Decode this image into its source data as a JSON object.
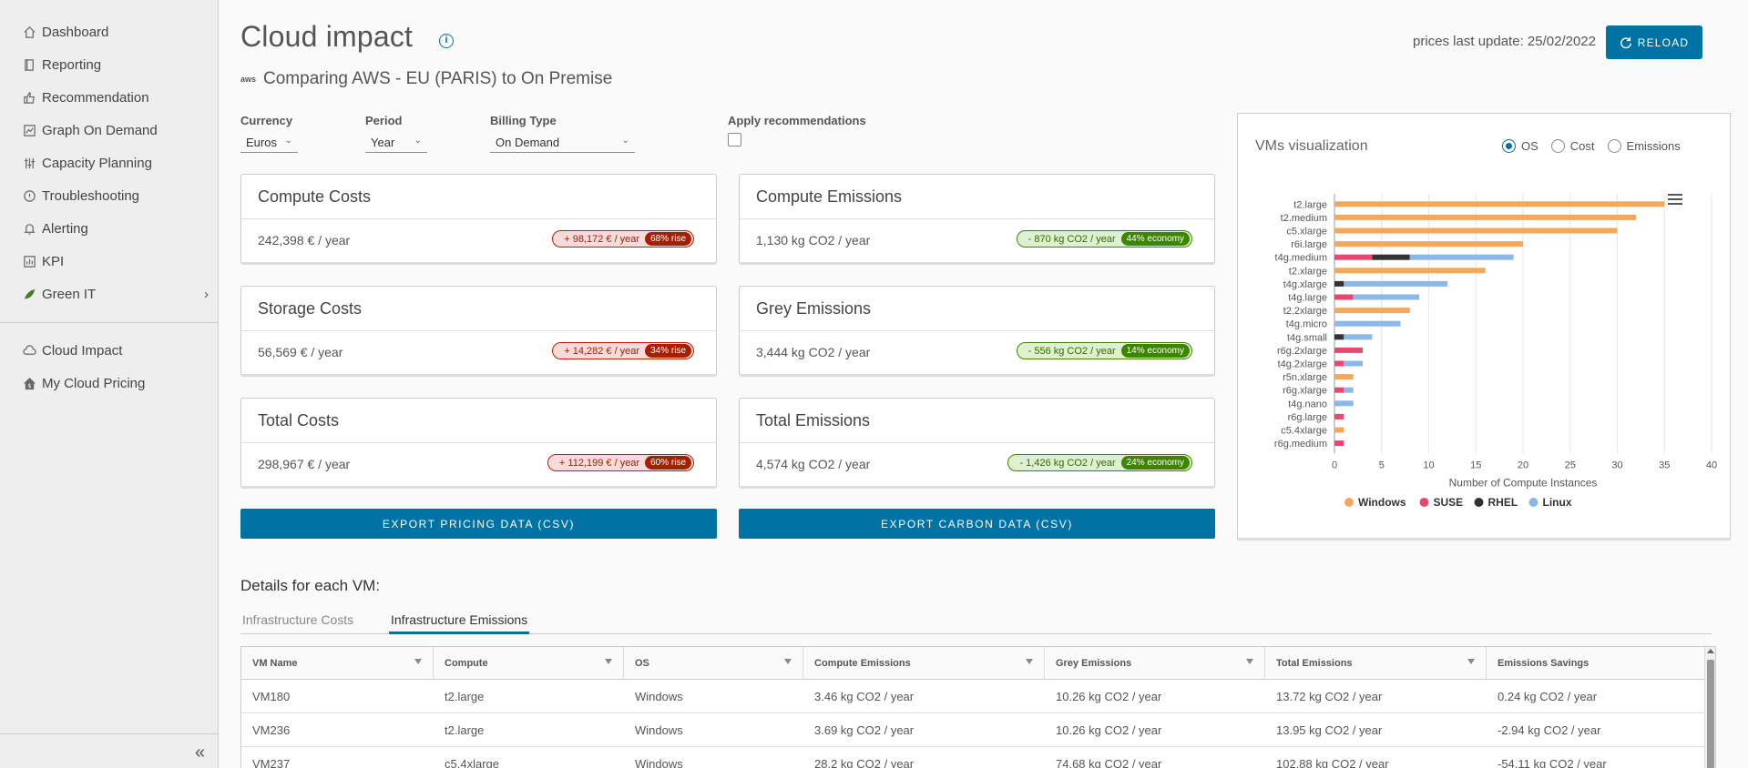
{
  "sidebar": {
    "items": [
      {
        "label": "Dashboard",
        "icon": "home-icon"
      },
      {
        "label": "Reporting",
        "icon": "book-icon"
      },
      {
        "label": "Recommendation",
        "icon": "thumbs-up-icon"
      },
      {
        "label": "Graph On Demand",
        "icon": "chart-icon"
      },
      {
        "label": "Capacity Planning",
        "icon": "sliders-icon"
      },
      {
        "label": "Troubleshooting",
        "icon": "warning-circle-icon"
      },
      {
        "label": "Alerting",
        "icon": "bell-icon"
      },
      {
        "label": "KPI",
        "icon": "kpi-icon"
      },
      {
        "label": "Green IT",
        "icon": "leaf-icon"
      },
      {
        "label": "Cloud Impact",
        "icon": "cloud-icon"
      },
      {
        "label": "My Cloud Pricing",
        "icon": "home-dollar-icon"
      }
    ]
  },
  "header": {
    "title": "Cloud impact",
    "subtitle": "Comparing AWS - EU (PARIS) to On Premise",
    "aws_logo": "aws",
    "prices_update": "prices last update: 25/02/2022",
    "reload_label": "RELOAD"
  },
  "filters": {
    "currency": {
      "label": "Currency",
      "value": "Euros"
    },
    "period": {
      "label": "Period",
      "value": "Year"
    },
    "billing": {
      "label": "Billing Type",
      "value": "On Demand"
    },
    "recommendations": {
      "label": "Apply recommendations",
      "checked": false
    }
  },
  "cards": {
    "compute_costs": {
      "title": "Compute Costs",
      "value": "242,398 € / year",
      "delta": "+ 98,172 € / year",
      "tag": "68% rise"
    },
    "compute_emissions": {
      "title": "Compute Emissions",
      "value": "1,130 kg CO2 / year",
      "delta": "- 870 kg CO2 / year",
      "tag": "44% economy"
    },
    "storage_costs": {
      "title": "Storage Costs",
      "value": "56,569 € / year",
      "delta": "+ 14,282 € / year",
      "tag": "34% rise"
    },
    "grey_emissions": {
      "title": "Grey Emissions",
      "value": "3,444 kg CO2 / year",
      "delta": "- 556 kg CO2 / year",
      "tag": "14% economy"
    },
    "total_costs": {
      "title": "Total Costs",
      "value": "298,967 € / year",
      "delta": "+ 112,199 € / year",
      "tag": "60% rise"
    },
    "total_emissions": {
      "title": "Total Emissions",
      "value": "4,574 kg CO2 / year",
      "delta": "- 1,426 kg CO2 / year",
      "tag": "24% economy"
    }
  },
  "exports": {
    "pricing": "EXPORT PRICING DATA (CSV)",
    "carbon": "EXPORT CARBON DATA (CSV)"
  },
  "viz": {
    "title": "VMs visualization",
    "radios": [
      "OS",
      "Cost",
      "Emissions"
    ],
    "selected": "OS"
  },
  "chart_data": {
    "type": "bar",
    "orientation": "horizontal",
    "stacked": true,
    "categories": [
      "t2.large",
      "t2.medium",
      "c5.xlarge",
      "r6i.large",
      "t4g.medium",
      "t2.xlarge",
      "t4g.xlarge",
      "t4g.large",
      "t2.2xlarge",
      "t4g.micro",
      "t4g.small",
      "r6g.2xlarge",
      "t4g.2xlarge",
      "r5n.xlarge",
      "r6g.xlarge",
      "t4g.nano",
      "r6g.large",
      "c5.4xlarge",
      "r6g.medium"
    ],
    "series": [
      {
        "name": "Windows",
        "color": "#f5a85a",
        "values": [
          35,
          32,
          30,
          20,
          0,
          16,
          0,
          0,
          8,
          0,
          0,
          0,
          0,
          2,
          0,
          0,
          0,
          1,
          0
        ]
      },
      {
        "name": "SUSE",
        "color": "#e8476f",
        "values": [
          0,
          0,
          0,
          0,
          4,
          0,
          0,
          2,
          0,
          0,
          0,
          3,
          1,
          0,
          1,
          0,
          1,
          0,
          1
        ]
      },
      {
        "name": "RHEL",
        "color": "#333333",
        "values": [
          0,
          0,
          0,
          0,
          4,
          0,
          1,
          0,
          0,
          0,
          1,
          0,
          0,
          0,
          0,
          0,
          0,
          0,
          0
        ]
      },
      {
        "name": "Linux",
        "color": "#8bb8e8",
        "values": [
          0,
          0,
          0,
          0,
          11,
          0,
          11,
          7,
          0,
          7,
          3,
          0,
          2,
          0,
          1,
          2,
          0,
          0,
          0
        ]
      }
    ],
    "xlabel": "Number of Compute Instances",
    "xlim": [
      0,
      40
    ],
    "xticks": [
      0,
      5,
      10,
      15,
      20,
      25,
      30,
      35,
      40
    ]
  },
  "details": {
    "title": "Details for each VM:",
    "tabs": [
      "Infrastructure Costs",
      "Infrastructure Emissions"
    ],
    "columns": [
      "VM Name",
      "Compute",
      "OS",
      "Compute Emissions",
      "Grey Emissions",
      "Total Emissions",
      "Emissions Savings"
    ],
    "rows": [
      [
        "VM180",
        "t2.large",
        "Windows",
        "3.46 kg CO2 / year",
        "10.26 kg CO2 / year",
        "13.72 kg CO2 / year",
        "0.24 kg CO2 / year"
      ],
      [
        "VM236",
        "t2.large",
        "Windows",
        "3.69 kg CO2 / year",
        "10.26 kg CO2 / year",
        "13.95 kg CO2 / year",
        "-2.94 kg CO2 / year"
      ],
      [
        "VM237",
        "c5.4xlarge",
        "Windows",
        "28.2 kg CO2 / year",
        "74.68 kg CO2 / year",
        "102.88 kg CO2 / year",
        "-54.11 kg CO2 / year"
      ]
    ]
  }
}
